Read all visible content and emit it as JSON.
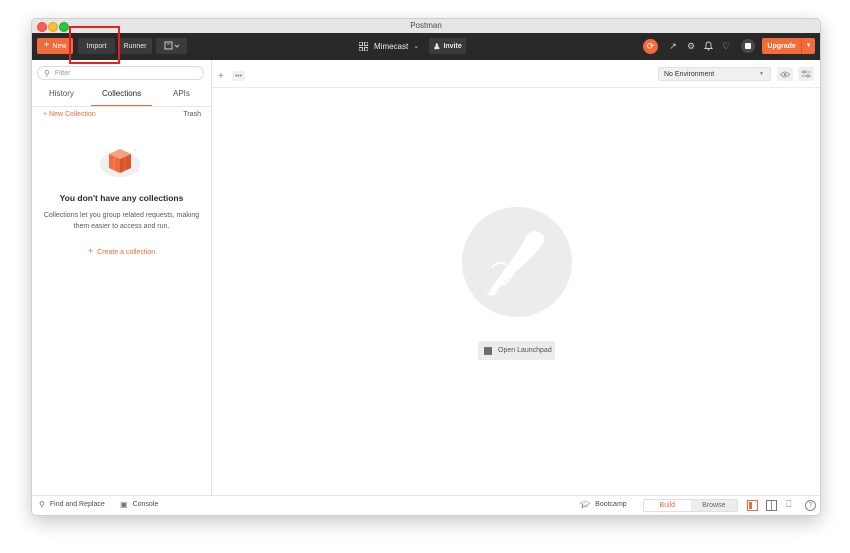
{
  "window": {
    "title": "Postman"
  },
  "header": {
    "new_label": "New",
    "import_label": "Import",
    "runner_label": "Runner",
    "workspace_label": "Mimecast",
    "invite_label": "Invite",
    "upgrade_label": "Upgrade",
    "icons": [
      "new-window-icon",
      "grid-icon",
      "sync-icon",
      "satellite-icon",
      "settings-icon",
      "bell-icon",
      "heart-icon",
      "avatar"
    ]
  },
  "sidebar": {
    "filter_placeholder": "Filter",
    "tabs": [
      {
        "label": "History"
      },
      {
        "label": "Collections",
        "active": true
      },
      {
        "label": "APIs"
      }
    ],
    "new_collection_label": "New Collection",
    "trash_label": "Trash",
    "empty_title": "You don't have any collections",
    "empty_desc": "Collections let you group related requests, making them easier to access and run.",
    "create_label": "Create a collection"
  },
  "main": {
    "environment": "No Environment",
    "launchpad_label": "Open Launchpad"
  },
  "footer": {
    "find_label": "Find and Replace",
    "console_label": "Console",
    "bootcamp_label": "Bootcamp",
    "build_label": "Build",
    "browse_label": "Browse"
  },
  "colors": {
    "accent": "#f26b3a",
    "header_bg": "#292929",
    "annotation": "#e8221a"
  }
}
